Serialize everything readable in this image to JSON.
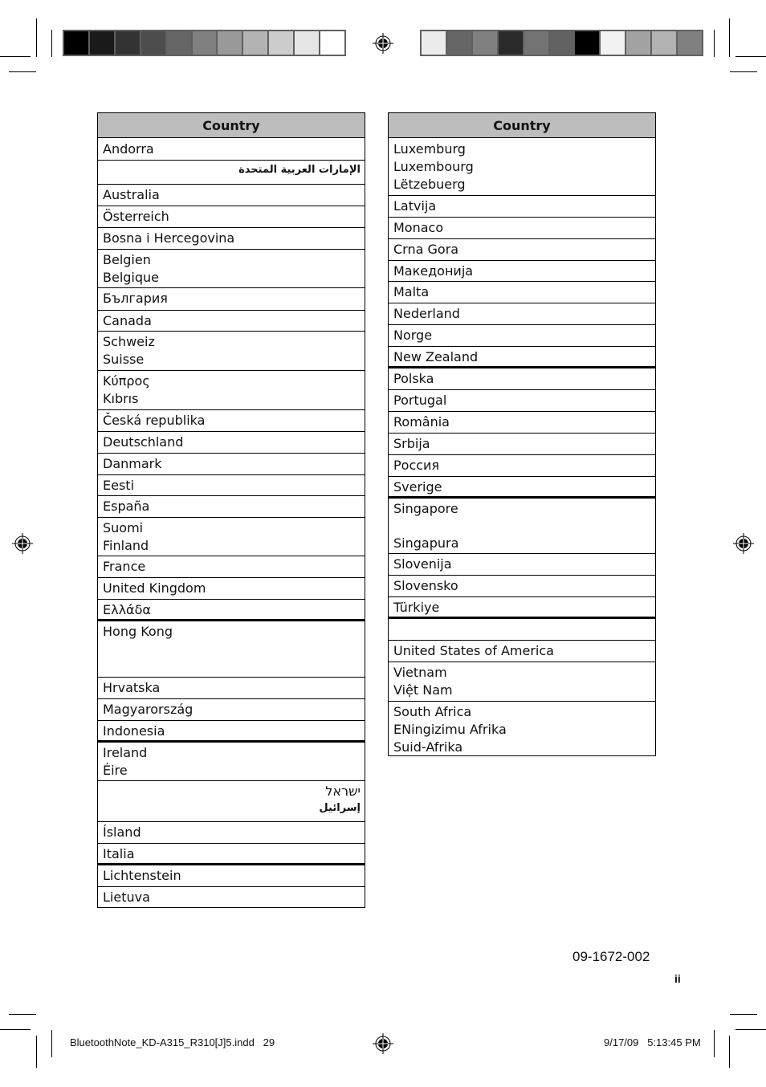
{
  "print_marks": {
    "color_bar_left": [
      "#000000",
      "#1a1a1a",
      "#333333",
      "#4d4d4d",
      "#666666",
      "#808080",
      "#999999",
      "#b3b3b3",
      "#cccccc",
      "#e6e6e6",
      "#ffffff"
    ],
    "color_bar_right": [
      "#ececec",
      "#666666",
      "#808080",
      "#2a2a2a",
      "#737373",
      "#626262",
      "#000000",
      "#f2f2f2",
      "#a3a3a3",
      "#b3b3b3",
      "#808080"
    ]
  },
  "tables": [
    {
      "header": "Country",
      "rows": [
        {
          "lines": [
            "Andorra"
          ]
        },
        {
          "lines": [
            "الإمارات العربية المتحدة"
          ],
          "rtl": true
        },
        {
          "lines": [
            "Australia"
          ]
        },
        {
          "lines": [
            "Österreich"
          ]
        },
        {
          "lines": [
            "Bosna i Hercegovina"
          ]
        },
        {
          "lines": [
            "Belgien",
            "Belgique"
          ]
        },
        {
          "lines": [
            "България"
          ]
        },
        {
          "lines": [
            "Canada"
          ]
        },
        {
          "lines": [
            "Schweiz",
            "Suisse"
          ]
        },
        {
          "lines": [
            "Κύπρος",
            "Kıbrıs"
          ]
        },
        {
          "lines": [
            "Česká republika"
          ]
        },
        {
          "lines": [
            "Deutschland"
          ]
        },
        {
          "lines": [
            "Danmark"
          ]
        },
        {
          "lines": [
            "Eesti"
          ]
        },
        {
          "lines": [
            "España"
          ]
        },
        {
          "lines": [
            "Suomi",
            "Finland"
          ]
        },
        {
          "lines": [
            "France"
          ]
        },
        {
          "lines": [
            "United Kingdom"
          ]
        },
        {
          "lines": [
            "Ελλάδα"
          ]
        },
        {
          "lines": [
            "Hong Kong"
          ]
        },
        {
          "lines": [
            "Hrvatska"
          ]
        },
        {
          "lines": [
            "Magyarország"
          ]
        },
        {
          "lines": [
            "Indonesia"
          ]
        },
        {
          "lines": [
            "Ireland",
            "Éire"
          ]
        },
        {
          "lines": [
            "ישראל",
            "إسرائيل"
          ],
          "rtl": true
        },
        {
          "lines": [
            "Ísland"
          ]
        },
        {
          "lines": [
            "Italia"
          ]
        },
        {
          "lines": [
            "Lichtenstein"
          ]
        },
        {
          "lines": [
            "Lietuva"
          ]
        }
      ]
    },
    {
      "header": "Country",
      "rows": [
        {
          "lines": [
            "Luxemburg",
            "Luxembourg",
            "Lëtzebuerg"
          ]
        },
        {
          "lines": [
            "Latvija"
          ]
        },
        {
          "lines": [
            "Monaco"
          ]
        },
        {
          "lines": [
            "Crna Gora"
          ]
        },
        {
          "lines": [
            "Македонија"
          ]
        },
        {
          "lines": [
            "Malta"
          ]
        },
        {
          "lines": [
            "Nederland"
          ]
        },
        {
          "lines": [
            "Norge"
          ]
        },
        {
          "lines": [
            "New Zealand"
          ]
        },
        {
          "lines": [
            "Polska"
          ]
        },
        {
          "lines": [
            "Portugal"
          ]
        },
        {
          "lines": [
            "România"
          ]
        },
        {
          "lines": [
            "Srbija"
          ]
        },
        {
          "lines": [
            "Россия"
          ]
        },
        {
          "lines": [
            "Sverige"
          ]
        },
        {
          "lines": [
            "Singapore",
            "Singapura"
          ]
        },
        {
          "lines": [
            "Slovenija"
          ]
        },
        {
          "lines": [
            "Slovensko"
          ]
        },
        {
          "lines": [
            "Türkiye"
          ]
        },
        {
          "lines": [
            ""
          ]
        },
        {
          "lines": [
            "United States of America"
          ]
        },
        {
          "lines": [
            "Vietnam",
            "Việt Nam"
          ]
        },
        {
          "lines": [
            "South Africa",
            "ENingizimu Afrika",
            "Suid-Afrika"
          ]
        }
      ]
    }
  ],
  "footer": {
    "doc_number": "09-1672-002",
    "page_label": "ii",
    "slug_filename": "BluetoothNote_KD-A315_R310[J]5.indd   29",
    "slug_datetime": "9/17/09   5:13:45 PM"
  }
}
